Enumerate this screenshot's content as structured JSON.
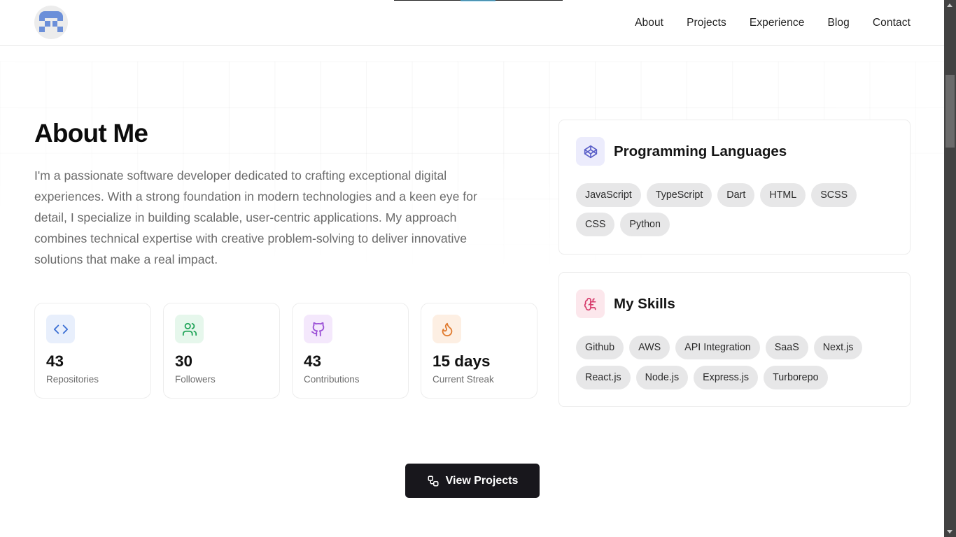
{
  "header": {
    "logo_alt": "pixel-art avatar logo",
    "nav": [
      {
        "label": "About"
      },
      {
        "label": "Projects"
      },
      {
        "label": "Experience"
      },
      {
        "label": "Blog"
      },
      {
        "label": "Contact"
      }
    ]
  },
  "about": {
    "title": "About Me",
    "description": "I'm a passionate software developer dedicated to crafting exceptional digital experiences. With a strong foundation in modern technologies and a keen eye for detail, I specialize in building scalable, user-centric applications. My approach combines technical expertise with creative problem-solving to deliver innovative solutions that make a real impact."
  },
  "stats": [
    {
      "icon": "code-icon",
      "value": "43",
      "label": "Repositories",
      "color": "#3b6fd4",
      "bg": "#e8effc"
    },
    {
      "icon": "users-icon",
      "value": "30",
      "label": "Followers",
      "color": "#22a55a",
      "bg": "#e6f7ec"
    },
    {
      "icon": "github-icon",
      "value": "43",
      "label": "Contributions",
      "color": "#9b4fd6",
      "bg": "#f4e8fc"
    },
    {
      "icon": "flame-icon",
      "value": "15 days",
      "label": "Current Streak",
      "color": "#e07a2e",
      "bg": "#fdefe3"
    }
  ],
  "languages": {
    "title": "Programming Languages",
    "icon": "codepen-icon",
    "icon_color": "#5a5fc8",
    "icon_bg": "#ececfc",
    "items": [
      "JavaScript",
      "TypeScript",
      "Dart",
      "HTML",
      "SCSS",
      "CSS",
      "Python"
    ]
  },
  "skills": {
    "title": "My Skills",
    "icon": "brain-icon",
    "icon_color": "#d63a6a",
    "icon_bg": "#fce7ec",
    "items": [
      "Github",
      "AWS",
      "API Integration",
      "SaaS",
      "Next.js",
      "React.js",
      "Node.js",
      "Express.js",
      "Turborepo"
    ]
  },
  "cta": {
    "label": "View Projects",
    "icon": "workflow-icon"
  }
}
